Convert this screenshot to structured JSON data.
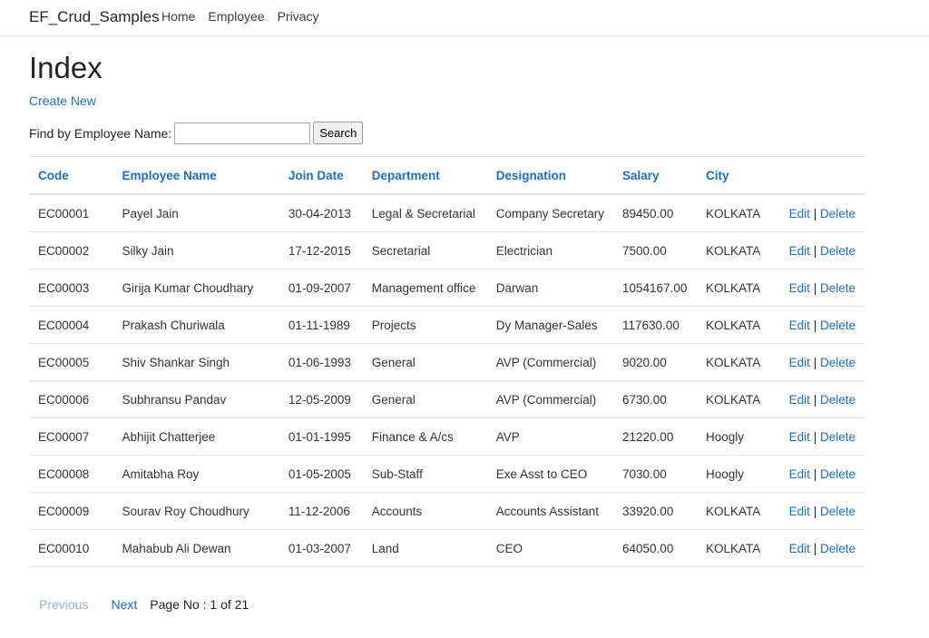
{
  "nav": {
    "brand": "EF_Crud_Samples",
    "links": [
      "Home",
      "Employee",
      "Privacy"
    ]
  },
  "page": {
    "title": "Index",
    "create_new": "Create New"
  },
  "search": {
    "label": "Find by Employee Name:",
    "value": "",
    "button": "Search"
  },
  "table": {
    "headers": [
      "Code",
      "Employee Name",
      "Join Date",
      "Department",
      "Designation",
      "Salary",
      "City"
    ],
    "rows": [
      [
        "EC00001",
        "Payel Jain",
        "30-04-2013",
        "Legal & Secretarial",
        "Company Secretary",
        "89450.00",
        "KOLKATA"
      ],
      [
        "EC00002",
        "Silky Jain",
        "17-12-2015",
        "Secretarial",
        "Electrician",
        "7500.00",
        "KOLKATA"
      ],
      [
        "EC00003",
        "Girija Kumar Choudhary",
        "01-09-2007",
        "Management office",
        "Darwan",
        "1054167.00",
        "KOLKATA"
      ],
      [
        "EC00004",
        "Prakash Churiwala",
        "01-11-1989",
        "Projects",
        "Dy Manager-Sales",
        "117630.00",
        "KOLKATA"
      ],
      [
        "EC00005",
        "Shiv Shankar Singh",
        "01-06-1993",
        "General",
        "AVP (Commercial)",
        "9020.00",
        "KOLKATA"
      ],
      [
        "EC00006",
        "Subhransu Pandav",
        "12-05-2009",
        "General",
        "AVP (Commercial)",
        "6730.00",
        "KOLKATA"
      ],
      [
        "EC00007",
        "Abhijit Chatterjee",
        "01-01-1995",
        "Finance & A/cs",
        "AVP",
        "21220.00",
        "Hoogly"
      ],
      [
        "EC00008",
        "Amitabha Roy",
        "01-05-2005",
        "Sub-Staff",
        "Exe Asst to CEO",
        "7030.00",
        "Hoogly"
      ],
      [
        "EC00009",
        "Sourav Roy Choudhury",
        "11-12-2006",
        "Accounts",
        "Accounts Assistant",
        "33920.00",
        "KOLKATA"
      ],
      [
        "EC00010",
        "Mahabub Ali Dewan",
        "01-03-2007",
        "Land",
        "CEO",
        "64050.00",
        "KOLKATA"
      ]
    ],
    "actions": {
      "edit": "Edit",
      "separator": "|",
      "delete": "Delete"
    }
  },
  "pager": {
    "previous": "Previous",
    "next": "Next",
    "info": "Page No : 1 of 21"
  },
  "colors": {
    "link": "#1b6ec2",
    "link_disabled": "#8fb4dc",
    "border": "#dee2e6"
  }
}
